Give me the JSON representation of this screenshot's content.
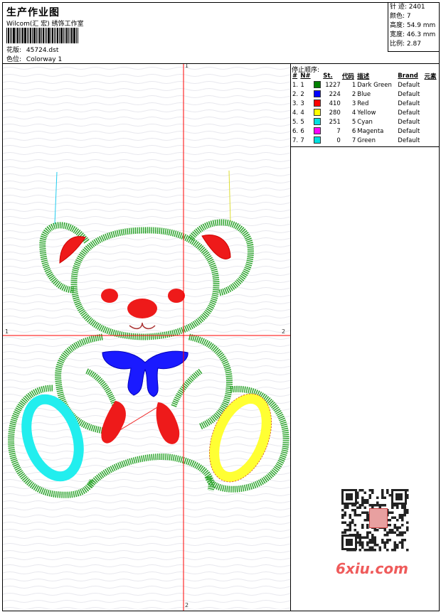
{
  "header": {
    "title": "生产作业图",
    "company": "Wilcom(汇 宏) 绣饰工作室",
    "design_label": "花版:",
    "design_value": "45724.dst",
    "colorway_label": "色位:",
    "colorway_value": "Colorway 1"
  },
  "stats": {
    "stitches": "针 迹: 2401",
    "colors": "颜色: 7",
    "height": "高度: 54.9 mm",
    "width": "宽度: 46.3 mm",
    "ratio": "比例: 2.87"
  },
  "axes": {
    "top": "1",
    "left": "1",
    "right": "2",
    "bottom": "2"
  },
  "stop_sequence": {
    "heading": "停止顺序:",
    "columns": [
      "#",
      "N#",
      "St.",
      "代码",
      "描述",
      "Brand",
      "元素"
    ],
    "rows": [
      {
        "idx": "1.",
        "n": "1",
        "color": "#008000",
        "st": "1227",
        "code": "1",
        "desc": "Dark Green",
        "brand": "Default"
      },
      {
        "idx": "2.",
        "n": "2",
        "color": "#0000ff",
        "st": "224",
        "code": "2",
        "desc": "Blue",
        "brand": "Default"
      },
      {
        "idx": "3.",
        "n": "3",
        "color": "#ff0000",
        "st": "410",
        "code": "3",
        "desc": "Red",
        "brand": "Default"
      },
      {
        "idx": "4.",
        "n": "4",
        "color": "#ffff00",
        "st": "280",
        "code": "4",
        "desc": "Yellow",
        "brand": "Default"
      },
      {
        "idx": "5.",
        "n": "5",
        "color": "#00e0e0",
        "st": "251",
        "code": "5",
        "desc": "Cyan",
        "brand": "Default"
      },
      {
        "idx": "6.",
        "n": "6",
        "color": "#ff00ff",
        "st": "7",
        "code": "6",
        "desc": "Magenta",
        "brand": "Default"
      },
      {
        "idx": "7.",
        "n": "7",
        "color": "#00e0e0",
        "st": "0",
        "code": "7",
        "desc": "Green",
        "brand": "Default"
      }
    ]
  },
  "watermark": "6xiu.com",
  "colors": {
    "green": "#2ea52e",
    "blue": "#1a1aff",
    "red": "#ee1a1a",
    "yellow": "#ffff33",
    "cyan": "#22eeee",
    "crosshair": "#ff0000"
  }
}
